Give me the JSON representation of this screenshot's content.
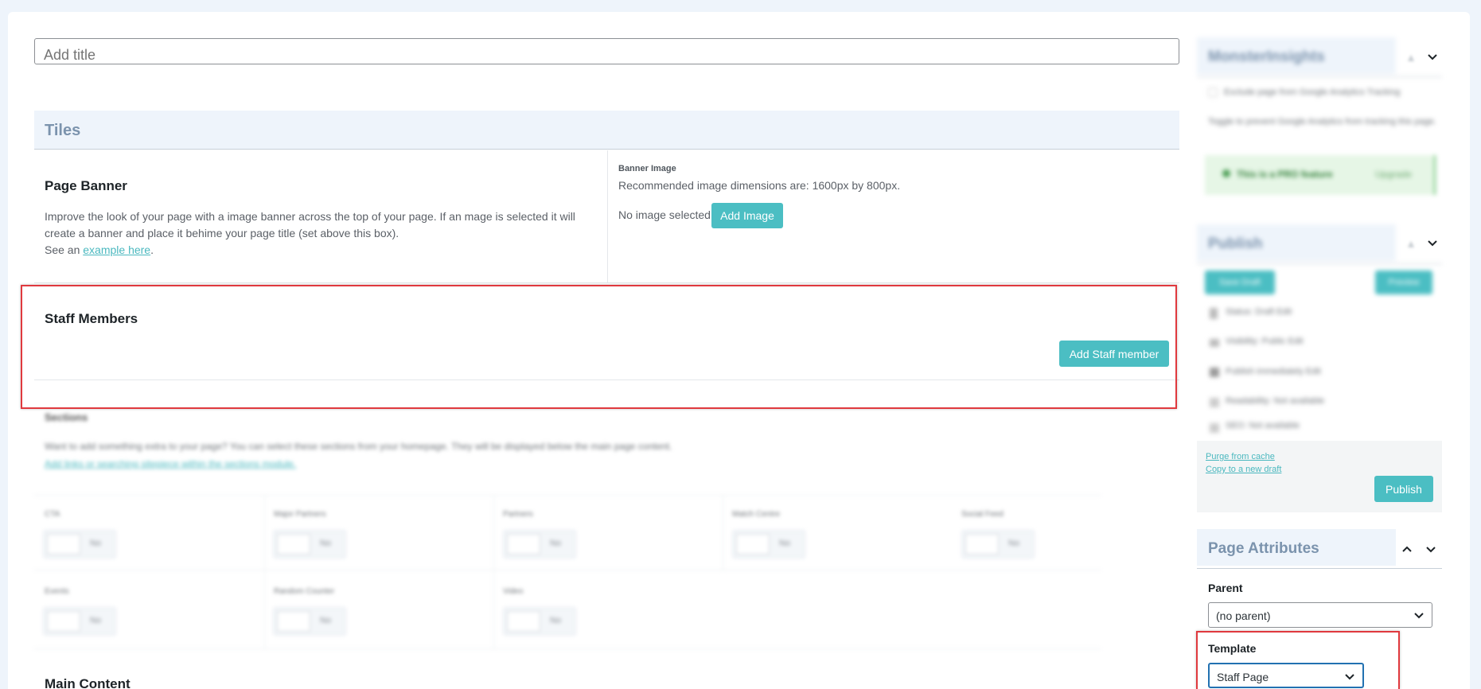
{
  "title_field": {
    "placeholder": "Add title"
  },
  "tiles": {
    "heading": "Tiles",
    "page_banner": {
      "title": "Page Banner",
      "description_line1": "Improve the look of your page with a image banner across the top of your page. If an mage is selected it will",
      "description_line2": "create a banner and place it behime your page title (set above this box).",
      "see_prefix": "See an ",
      "see_link": "example here",
      "see_suffix": ".",
      "banner_label": "Banner Image",
      "recommendation": "Recommended image dimensions are: 1600px by 800px.",
      "no_image": "No image selected",
      "add_image": "Add Image"
    },
    "staff_members": {
      "title": "Staff Members",
      "add_button": "Add Staff member"
    },
    "sections": {
      "title": "Sections",
      "description": "Want to add something extra to your page? You can select these sections from your homepage. They will be displayed below the main page content.",
      "link": "Add links or searching sitepiece within the sections module.",
      "fields": [
        {
          "label": "CTA",
          "unit": "No"
        },
        {
          "label": "Major Partners",
          "unit": "No"
        },
        {
          "label": "Partners",
          "unit": "No"
        },
        {
          "label": "Match Centre",
          "unit": "No"
        },
        {
          "label": "Social Feed",
          "unit": "No"
        },
        {
          "label": "Events",
          "unit": "No"
        },
        {
          "label": "Random Counter",
          "unit": "No"
        },
        {
          "label": "Video",
          "unit": "No"
        }
      ]
    },
    "main_content": {
      "title": "Main Content"
    }
  },
  "sidebar": {
    "monsterinsights": {
      "title": "MonsterInsights",
      "checkbox_label": "Exclude page from Google Analytics Tracking",
      "help": "Toggle to prevent Google Analytics from tracking this page.",
      "pro_badge": "This is a PRO feature",
      "upgrade": "Upgrade"
    },
    "publish": {
      "title": "Publish",
      "save_draft": "Save Draft",
      "preview": "Preview",
      "status": "Status: Draft Edit",
      "visibility": "Visibility: Public Edit",
      "publish_time": "Publish immediately Edit",
      "readability": "Readability: Not available",
      "seo": "SEO: Not available",
      "purge": "Purge from cache",
      "copy": "Copy to a new draft",
      "publish_button": "Publish"
    },
    "page_attributes": {
      "title": "Page Attributes",
      "parent_label": "Parent",
      "parent_value": "(no parent)",
      "template_label": "Template",
      "template_value": "Staff Page"
    }
  },
  "colors": {
    "accent": "#4bbec3",
    "highlight": "#e0393e",
    "panel_header": "#eef4fb"
  }
}
